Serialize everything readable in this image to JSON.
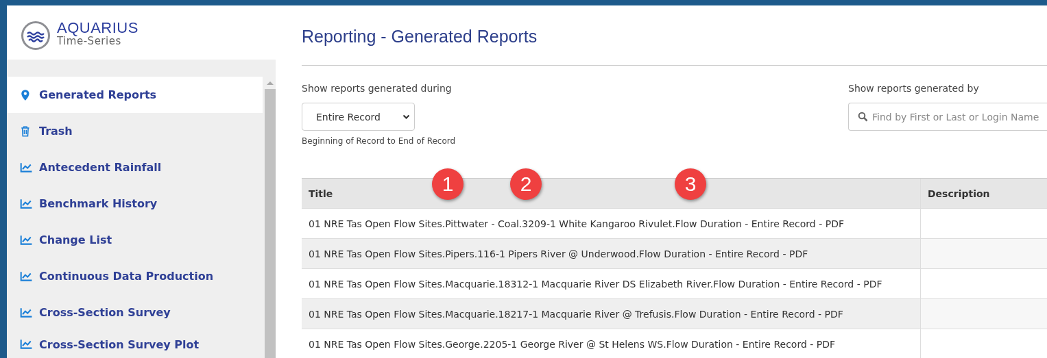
{
  "logo": {
    "name": "AQUARIUS",
    "subtitle": "Time-Series"
  },
  "sidebar": {
    "items": [
      {
        "label": "Generated Reports",
        "kind": "location",
        "selected": true
      },
      {
        "label": "Trash",
        "kind": "trash",
        "selected": false
      },
      {
        "label": "Antecedent Rainfall",
        "kind": "report",
        "selected": false
      },
      {
        "label": "Benchmark History",
        "kind": "report",
        "selected": false
      },
      {
        "label": "Change List",
        "kind": "report",
        "selected": false
      },
      {
        "label": "Continuous Data Production",
        "kind": "report",
        "selected": false
      },
      {
        "label": "Cross-Section Survey",
        "kind": "report",
        "selected": false
      },
      {
        "label": "Cross-Section Survey Plot",
        "kind": "report",
        "selected": false
      }
    ]
  },
  "page_title": "Reporting - Generated Reports",
  "filters": {
    "period": {
      "label": "Show reports generated during",
      "value": "Entire Record",
      "hint": "Beginning of Record to End of Record"
    },
    "user": {
      "label": "Show reports generated by",
      "placeholder": "Find by First or Last or Login Name"
    }
  },
  "table": {
    "columns": [
      "Title",
      "Description"
    ],
    "rows": [
      {
        "title": "01 NRE Tas Open Flow Sites.Pittwater - Coal.3209-1 White Kangaroo Rivulet.Flow Duration - Entire Record - PDF"
      },
      {
        "title": "01 NRE Tas Open Flow Sites.Pipers.116-1 Pipers River @ Underwood.Flow Duration - Entire Record - PDF"
      },
      {
        "title": "01 NRE Tas Open Flow Sites.Macquarie.18312-1 Macquarie River DS Elizabeth River.Flow Duration - Entire Record - PDF"
      },
      {
        "title": "01 NRE Tas Open Flow Sites.Macquarie.18217-1 Macquarie River @ Trefusis.Flow Duration - Entire Record - PDF"
      },
      {
        "title": "01 NRE Tas Open Flow Sites.George.2205-1 George River @ St Helens WS.Flow Duration - Entire Record - PDF"
      }
    ]
  },
  "callouts": [
    "1",
    "2",
    "3"
  ]
}
